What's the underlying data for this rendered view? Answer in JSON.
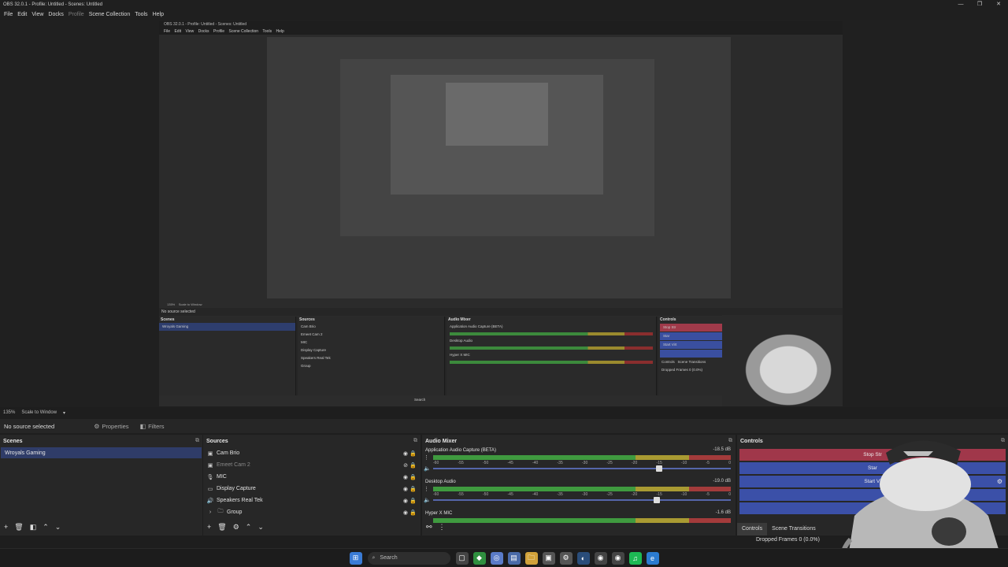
{
  "window": {
    "title": "OBS 32.0.1 - Profile: Untitled - Scenes: Untitled",
    "min": "—",
    "max": "❐",
    "close": "✕"
  },
  "menu": [
    "File",
    "Edit",
    "View",
    "Docks",
    "Profile",
    "Scene Collection",
    "Tools",
    "Help"
  ],
  "preview": {
    "zoom": "135%",
    "scale_mode": "Scale to Window",
    "nested_title": "OBS 32.0.1 - Profile: Untitled - Scenes: Untitled",
    "nested_menu": [
      "File",
      "Edit",
      "View",
      "Docks",
      "Profile",
      "Scene Collection",
      "Tools",
      "Help"
    ],
    "nested_zoom": "135%",
    "nested_scale": "Scale to Window",
    "nested_no_source": "No source selected",
    "nested_scene": "Wroyals Gaming",
    "nested_sources": [
      "Cam Brio",
      "Emeet Cam 2",
      "MIC",
      "Display Capture",
      "Speakers Real Tek",
      "Group"
    ],
    "nested_mixer_channels": [
      "Application Audio Capture (BETA)",
      "Desktop Audio",
      "Hyper X MIC"
    ],
    "nested_controls": [
      "Stop Str",
      "Star",
      "Start Virt"
    ],
    "nested_tabs": [
      "Controls",
      "Scene Transitions"
    ],
    "nested_dropped": "Dropped Frames 0 (0.0%)",
    "nested_search": "Search"
  },
  "source_bar": {
    "no_source": "No source selected",
    "properties": "Properties",
    "filters": "Filters"
  },
  "scenes": {
    "title": "Scenes",
    "items": [
      "Wroyals Gaming"
    ]
  },
  "sources": {
    "title": "Sources",
    "items": [
      {
        "label": "Cam Brio",
        "icon": "camera-icon"
      },
      {
        "label": "Emeet Cam 2",
        "icon": "camera-icon"
      },
      {
        "label": "MIC",
        "icon": "microphone-icon"
      },
      {
        "label": "Display Capture",
        "icon": "monitor-icon"
      },
      {
        "label": "Speakers Real Tek",
        "icon": "speaker-icon"
      },
      {
        "label": "Group",
        "icon": "folder-icon"
      }
    ]
  },
  "mixer": {
    "title": "Audio Mixer",
    "channels": [
      {
        "name": "Application Audio Capture (BETA)",
        "db": "-18.5 dB",
        "volume": 0.76
      },
      {
        "name": "Desktop Audio",
        "db": "-19.0 dB",
        "volume": 0.75
      },
      {
        "name": "Hyper X MIC",
        "db": "-1.6 dB",
        "volume": 0.95
      }
    ],
    "ticks": [
      "-60",
      "-55",
      "-50",
      "-45",
      "-40",
      "-35",
      "-30",
      "-25",
      "-20",
      "-15",
      "-10",
      "-5",
      "0"
    ]
  },
  "controls": {
    "title": "Controls",
    "buttons": [
      "Stop Str",
      "Star",
      "Start Vi"
    ],
    "tabs": [
      "Controls",
      "Scene Transitions"
    ]
  },
  "status": {
    "dropped": "Dropped Frames 0 (0.0%)"
  },
  "taskbar": {
    "search": "Search"
  },
  "colors": {
    "accent": "#3b50a8",
    "stop": "#a0374a",
    "selection": "#2f3c68"
  }
}
